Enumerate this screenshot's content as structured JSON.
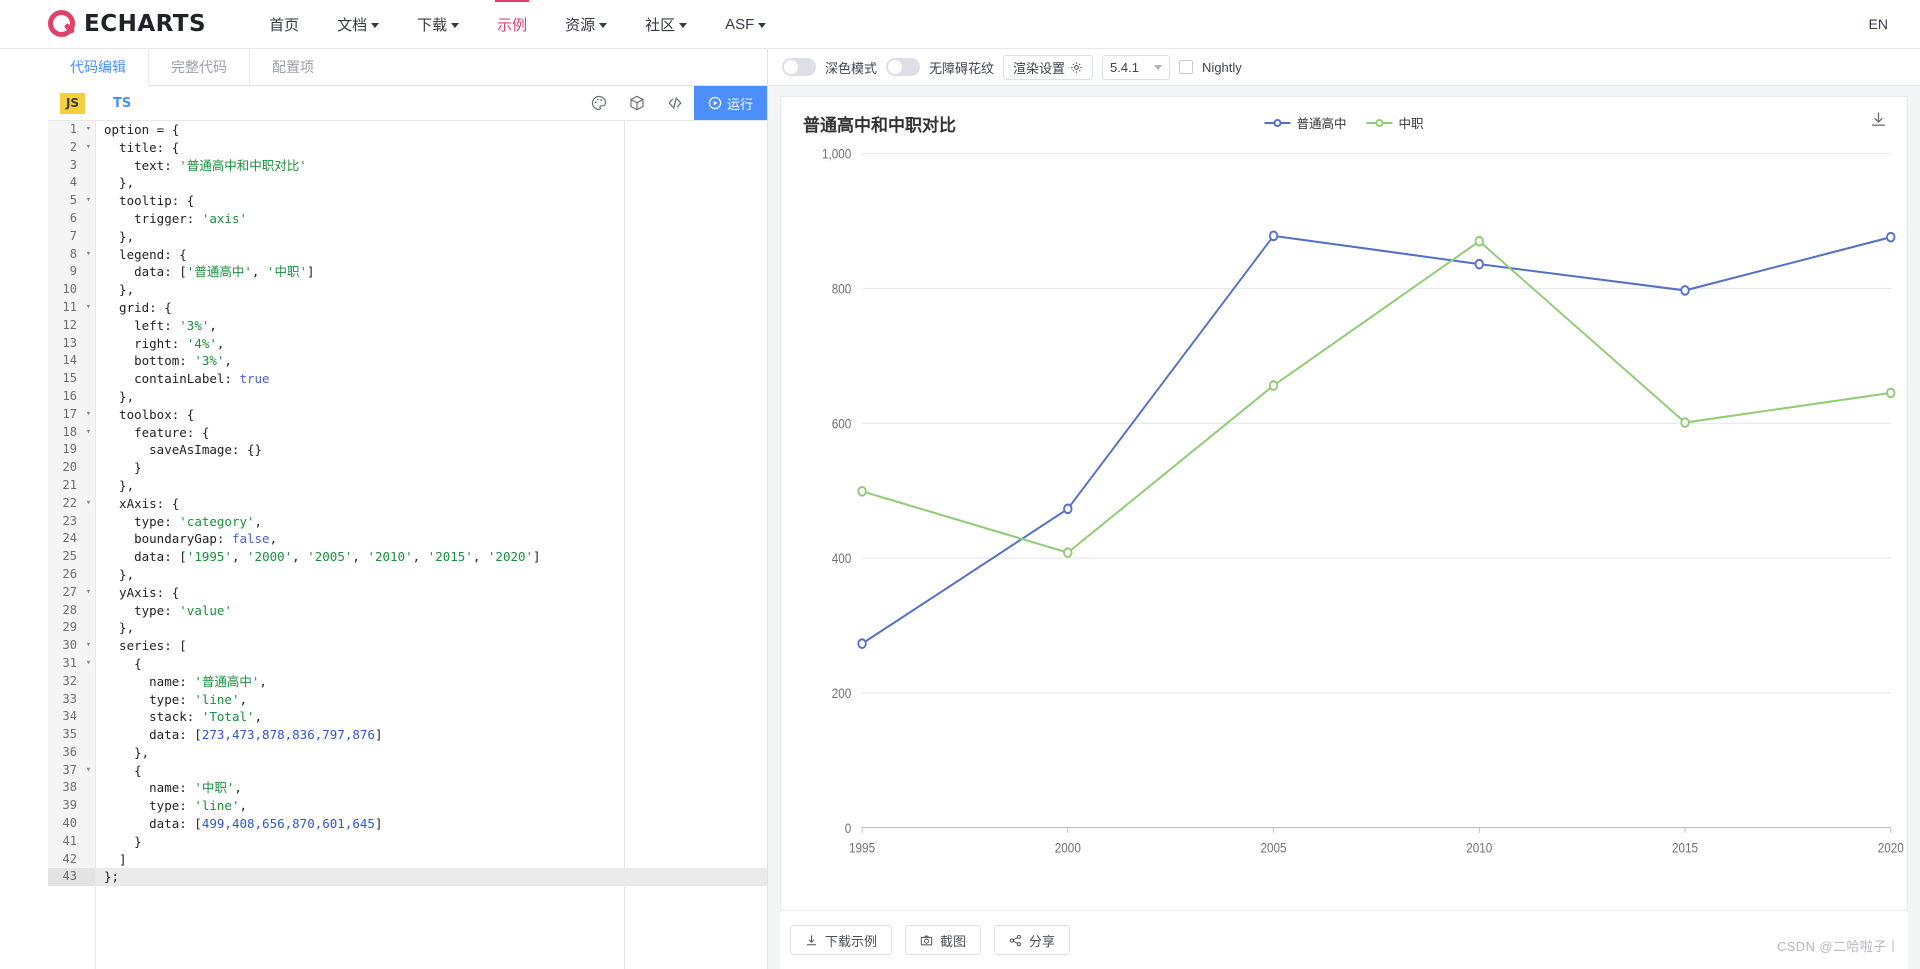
{
  "topnav": {
    "brand": "ECHARTS",
    "links": [
      {
        "label": "首页",
        "caret": false,
        "active": false
      },
      {
        "label": "文档",
        "caret": true,
        "active": false
      },
      {
        "label": "下载",
        "caret": true,
        "active": false
      },
      {
        "label": "示例",
        "caret": false,
        "active": true
      },
      {
        "label": "资源",
        "caret": true,
        "active": false
      },
      {
        "label": "社区",
        "caret": true,
        "active": false
      },
      {
        "label": "ASF",
        "caret": true,
        "active": false
      }
    ],
    "lang": "EN"
  },
  "editor": {
    "tabs": [
      {
        "label": "代码编辑",
        "active": true
      },
      {
        "label": "完整代码",
        "active": false
      },
      {
        "label": "配置项",
        "active": false
      }
    ],
    "js_badge": "JS",
    "ts_badge": "TS",
    "icons": [
      "palette-icon",
      "cube-icon",
      "code-brackets-icon"
    ],
    "run_label": "运行",
    "current_line": 43,
    "code_lines": [
      {
        "n": 1,
        "fold": "▾",
        "tokens": [
          {
            "t": "option = {",
            "c": "plain"
          }
        ]
      },
      {
        "n": 2,
        "fold": "▾",
        "tokens": [
          {
            "t": "  title: {",
            "c": "plain"
          }
        ]
      },
      {
        "n": 3,
        "fold": "",
        "tokens": [
          {
            "t": "    text: ",
            "c": "plain"
          },
          {
            "t": "'普通高中和中职对比'",
            "c": "str"
          }
        ]
      },
      {
        "n": 4,
        "fold": "",
        "tokens": [
          {
            "t": "  },",
            "c": "plain"
          }
        ]
      },
      {
        "n": 5,
        "fold": "▾",
        "tokens": [
          {
            "t": "  tooltip: {",
            "c": "plain"
          }
        ]
      },
      {
        "n": 6,
        "fold": "",
        "tokens": [
          {
            "t": "    trigger: ",
            "c": "plain"
          },
          {
            "t": "'axis'",
            "c": "str"
          }
        ]
      },
      {
        "n": 7,
        "fold": "",
        "tokens": [
          {
            "t": "  },",
            "c": "plain"
          }
        ]
      },
      {
        "n": 8,
        "fold": "▾",
        "tokens": [
          {
            "t": "  legend: {",
            "c": "plain"
          }
        ]
      },
      {
        "n": 9,
        "fold": "",
        "tokens": [
          {
            "t": "    data: [",
            "c": "plain"
          },
          {
            "t": "'普通高中'",
            "c": "str"
          },
          {
            "t": ", ",
            "c": "plain"
          },
          {
            "t": "'中职'",
            "c": "str"
          },
          {
            "t": "]",
            "c": "plain"
          }
        ]
      },
      {
        "n": 10,
        "fold": "",
        "tokens": [
          {
            "t": "  },",
            "c": "plain"
          }
        ]
      },
      {
        "n": 11,
        "fold": "▾",
        "tokens": [
          {
            "t": "  grid: {",
            "c": "plain"
          }
        ]
      },
      {
        "n": 12,
        "fold": "",
        "tokens": [
          {
            "t": "    left: ",
            "c": "plain"
          },
          {
            "t": "'3%'",
            "c": "str"
          },
          {
            "t": ",",
            "c": "plain"
          }
        ]
      },
      {
        "n": 13,
        "fold": "",
        "tokens": [
          {
            "t": "    right: ",
            "c": "plain"
          },
          {
            "t": "'4%'",
            "c": "str"
          },
          {
            "t": ",",
            "c": "plain"
          }
        ]
      },
      {
        "n": 14,
        "fold": "",
        "tokens": [
          {
            "t": "    bottom: ",
            "c": "plain"
          },
          {
            "t": "'3%'",
            "c": "str"
          },
          {
            "t": ",",
            "c": "plain"
          }
        ]
      },
      {
        "n": 15,
        "fold": "",
        "tokens": [
          {
            "t": "    containLabel: ",
            "c": "plain"
          },
          {
            "t": "true",
            "c": "kw"
          }
        ]
      },
      {
        "n": 16,
        "fold": "",
        "tokens": [
          {
            "t": "  },",
            "c": "plain"
          }
        ]
      },
      {
        "n": 17,
        "fold": "▾",
        "tokens": [
          {
            "t": "  toolbox: {",
            "c": "plain"
          }
        ]
      },
      {
        "n": 18,
        "fold": "▾",
        "tokens": [
          {
            "t": "    feature: {",
            "c": "plain"
          }
        ]
      },
      {
        "n": 19,
        "fold": "",
        "tokens": [
          {
            "t": "      saveAsImage: {}",
            "c": "plain"
          }
        ]
      },
      {
        "n": 20,
        "fold": "",
        "tokens": [
          {
            "t": "    }",
            "c": "plain"
          }
        ]
      },
      {
        "n": 21,
        "fold": "",
        "tokens": [
          {
            "t": "  },",
            "c": "plain"
          }
        ]
      },
      {
        "n": 22,
        "fold": "▾",
        "tokens": [
          {
            "t": "  xAxis: {",
            "c": "plain"
          }
        ]
      },
      {
        "n": 23,
        "fold": "",
        "tokens": [
          {
            "t": "    type: ",
            "c": "plain"
          },
          {
            "t": "'category'",
            "c": "str"
          },
          {
            "t": ",",
            "c": "plain"
          }
        ]
      },
      {
        "n": 24,
        "fold": "",
        "tokens": [
          {
            "t": "    boundaryGap: ",
            "c": "plain"
          },
          {
            "t": "false",
            "c": "kw"
          },
          {
            "t": ",",
            "c": "plain"
          }
        ]
      },
      {
        "n": 25,
        "fold": "",
        "tokens": [
          {
            "t": "    data: [",
            "c": "plain"
          },
          {
            "t": "'1995'",
            "c": "str"
          },
          {
            "t": ", ",
            "c": "plain"
          },
          {
            "t": "'2000'",
            "c": "str"
          },
          {
            "t": ", ",
            "c": "plain"
          },
          {
            "t": "'2005'",
            "c": "str"
          },
          {
            "t": ", ",
            "c": "plain"
          },
          {
            "t": "'2010'",
            "c": "str"
          },
          {
            "t": ", ",
            "c": "plain"
          },
          {
            "t": "'2015'",
            "c": "str"
          },
          {
            "t": ", ",
            "c": "plain"
          },
          {
            "t": "'2020'",
            "c": "str"
          },
          {
            "t": "]",
            "c": "plain"
          }
        ]
      },
      {
        "n": 26,
        "fold": "",
        "tokens": [
          {
            "t": "  },",
            "c": "plain"
          }
        ]
      },
      {
        "n": 27,
        "fold": "▾",
        "tokens": [
          {
            "t": "  yAxis: {",
            "c": "plain"
          }
        ]
      },
      {
        "n": 28,
        "fold": "",
        "tokens": [
          {
            "t": "    type: ",
            "c": "plain"
          },
          {
            "t": "'value'",
            "c": "str"
          }
        ]
      },
      {
        "n": 29,
        "fold": "",
        "tokens": [
          {
            "t": "  },",
            "c": "plain"
          }
        ]
      },
      {
        "n": 30,
        "fold": "▾",
        "tokens": [
          {
            "t": "  series: [",
            "c": "plain"
          }
        ]
      },
      {
        "n": 31,
        "fold": "▾",
        "tokens": [
          {
            "t": "    {",
            "c": "plain"
          }
        ]
      },
      {
        "n": 32,
        "fold": "",
        "tokens": [
          {
            "t": "      name: ",
            "c": "plain"
          },
          {
            "t": "'普通高中'",
            "c": "str"
          },
          {
            "t": ",",
            "c": "plain"
          }
        ]
      },
      {
        "n": 33,
        "fold": "",
        "tokens": [
          {
            "t": "      type: ",
            "c": "plain"
          },
          {
            "t": "'line'",
            "c": "str"
          },
          {
            "t": ",",
            "c": "plain"
          }
        ]
      },
      {
        "n": 34,
        "fold": "",
        "tokens": [
          {
            "t": "      stack: ",
            "c": "plain"
          },
          {
            "t": "'Total'",
            "c": "str"
          },
          {
            "t": ",",
            "c": "plain"
          }
        ]
      },
      {
        "n": 35,
        "fold": "",
        "tokens": [
          {
            "t": "      data: [",
            "c": "plain"
          },
          {
            "t": "273,473,878,836,797,876",
            "c": "num"
          },
          {
            "t": "]",
            "c": "plain"
          }
        ]
      },
      {
        "n": 36,
        "fold": "",
        "tokens": [
          {
            "t": "    },",
            "c": "plain"
          }
        ]
      },
      {
        "n": 37,
        "fold": "▾",
        "tokens": [
          {
            "t": "    {",
            "c": "plain"
          }
        ]
      },
      {
        "n": 38,
        "fold": "",
        "tokens": [
          {
            "t": "      name: ",
            "c": "plain"
          },
          {
            "t": "'中职'",
            "c": "str"
          },
          {
            "t": ",",
            "c": "plain"
          }
        ]
      },
      {
        "n": 39,
        "fold": "",
        "tokens": [
          {
            "t": "      type: ",
            "c": "plain"
          },
          {
            "t": "'line'",
            "c": "str"
          },
          {
            "t": ",",
            "c": "plain"
          }
        ]
      },
      {
        "n": 40,
        "fold": "",
        "tokens": [
          {
            "t": "      data: [",
            "c": "plain"
          },
          {
            "t": "499,408,656,870,601,645",
            "c": "num"
          },
          {
            "t": "]",
            "c": "plain"
          }
        ]
      },
      {
        "n": 41,
        "fold": "",
        "tokens": [
          {
            "t": "    }",
            "c": "plain"
          }
        ]
      },
      {
        "n": 42,
        "fold": "",
        "tokens": [
          {
            "t": "  ]",
            "c": "plain"
          }
        ]
      },
      {
        "n": 43,
        "fold": "",
        "tokens": [
          {
            "t": "};",
            "c": "plain"
          }
        ]
      }
    ]
  },
  "preview_toolbar": {
    "dark_mode_label": "深色模式",
    "dark_mode_on": false,
    "pattern_label": "无障碍花纹",
    "pattern_on": false,
    "render_settings_label": "渲染设置",
    "version": "5.4.1",
    "nightly_label": "Nightly",
    "nightly_checked": false
  },
  "preview_actions": {
    "download_label": "下载示例",
    "screenshot_label": "截图",
    "share_label": "分享"
  },
  "watermark": "CSDN @二哈啦子丨",
  "chart_data": {
    "type": "line",
    "title": "普通高中和中职对比",
    "xlabel": "",
    "ylabel": "",
    "categories": [
      "1995",
      "2000",
      "2005",
      "2010",
      "2015",
      "2020"
    ],
    "series": [
      {
        "name": "普通高中",
        "values": [
          273,
          473,
          878,
          836,
          797,
          876
        ],
        "color": "#5470c6"
      },
      {
        "name": "中职",
        "values": [
          499,
          408,
          656,
          870,
          601,
          645
        ],
        "color": "#91cc75"
      }
    ],
    "ylim": [
      0,
      1000
    ],
    "y_ticks": [
      "0",
      "200",
      "400",
      "600",
      "800",
      "1,000"
    ],
    "y_tick_values": [
      0,
      200,
      400,
      600,
      800,
      1000
    ],
    "grid": true,
    "legend_position": "top-center",
    "toolbox": [
      "saveAsImage"
    ]
  }
}
